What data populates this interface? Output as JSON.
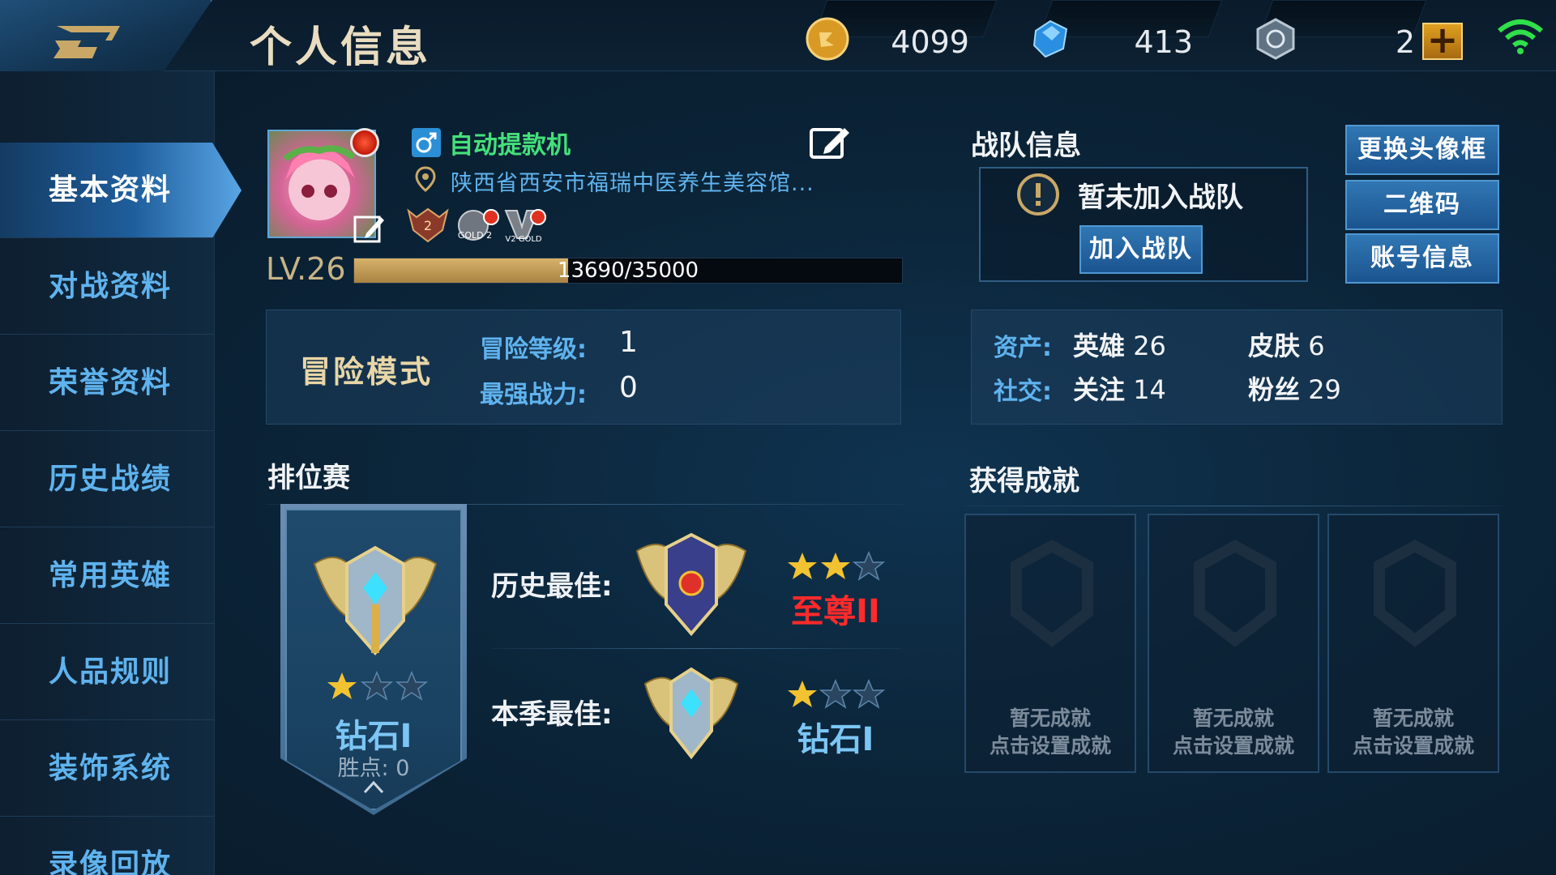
{
  "header": {
    "title": "个人信息",
    "gold": "4099",
    "diamond": "413",
    "voucher": "2"
  },
  "sidebar": {
    "items": [
      {
        "label": "基本资料",
        "active": true
      },
      {
        "label": "对战资料"
      },
      {
        "label": "荣誉资料"
      },
      {
        "label": "历史战绩"
      },
      {
        "label": "常用英雄"
      },
      {
        "label": "人品规则"
      },
      {
        "label": "装饰系统"
      },
      {
        "label": "录像回放"
      }
    ]
  },
  "profile": {
    "name": "自动提款机",
    "location": "陕西省西安市福瑞中医养生美容馆...",
    "level": "LV.26",
    "xp_text": "13690/35000",
    "xp_fraction": 0.391,
    "badges": [
      "2",
      "GOLD 2",
      "V2 GOLD"
    ]
  },
  "adventure": {
    "label": "冒险模式",
    "level_key": "冒险等级:",
    "level_val": "1",
    "power_key": "最强战力:",
    "power_val": "0"
  },
  "team": {
    "title": "战队信息",
    "status": "暂未加入战队",
    "join_button": "加入战队"
  },
  "side_buttons": {
    "frame": "更换头像框",
    "qrcode": "二维码",
    "account": "账号信息"
  },
  "assets": {
    "asset_key": "资产:",
    "heroes_key": "英雄",
    "heroes_val": "26",
    "skins_key": "皮肤",
    "skins_val": "6",
    "social_key": "社交:",
    "follow_key": "关注",
    "follow_val": "14",
    "fans_key": "粉丝",
    "fans_val": "29"
  },
  "ranked": {
    "title": "排位赛",
    "current_rank": "钻石I",
    "current_stars": 1,
    "points_label": "胜点: 0",
    "history_label": "历史最佳:",
    "history_rank": "至尊II",
    "history_stars": 2,
    "season_label": "本季最佳:",
    "season_rank": "钻石I",
    "season_stars": 1
  },
  "achievements": {
    "title": "获得成就",
    "cards": [
      {
        "line1": "暂无成就",
        "line2": "点击设置成就"
      },
      {
        "line1": "暂无成就",
        "line2": "点击设置成就"
      },
      {
        "line1": "暂无成就",
        "line2": "点击设置成就"
      }
    ]
  },
  "colors": {
    "accent_blue": "#5fb3ee",
    "name_green": "#45e07a",
    "gold_title": "#e8d6a6",
    "rank_red": "#ff2a2a"
  }
}
